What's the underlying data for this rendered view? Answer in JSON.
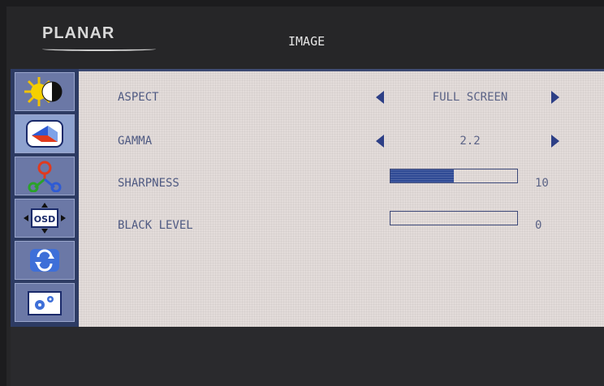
{
  "brand": "PLANAR",
  "menu_title": "IMAGE",
  "sidebar": [
    {
      "icon": "brightness-contrast-icon"
    },
    {
      "icon": "image-icon",
      "active": true
    },
    {
      "icon": "color-icon"
    },
    {
      "icon": "osd-icon"
    },
    {
      "icon": "reset-icon"
    },
    {
      "icon": "setup-icon"
    }
  ],
  "settings": {
    "aspect": {
      "label": "ASPECT",
      "value": "FULL SCREEN"
    },
    "gamma": {
      "label": "GAMMA",
      "value": "2.2"
    },
    "sharpness": {
      "label": "SHARPNESS",
      "value": "10",
      "level": 0.5
    },
    "black_level": {
      "label": "BLACK LEVEL",
      "value": "0",
      "level": 0
    }
  },
  "osd_icon_text": "OSD",
  "colors": {
    "panel": "#e3dcda",
    "sidebar": "#2d3b63",
    "accent": "#2d3f86"
  }
}
